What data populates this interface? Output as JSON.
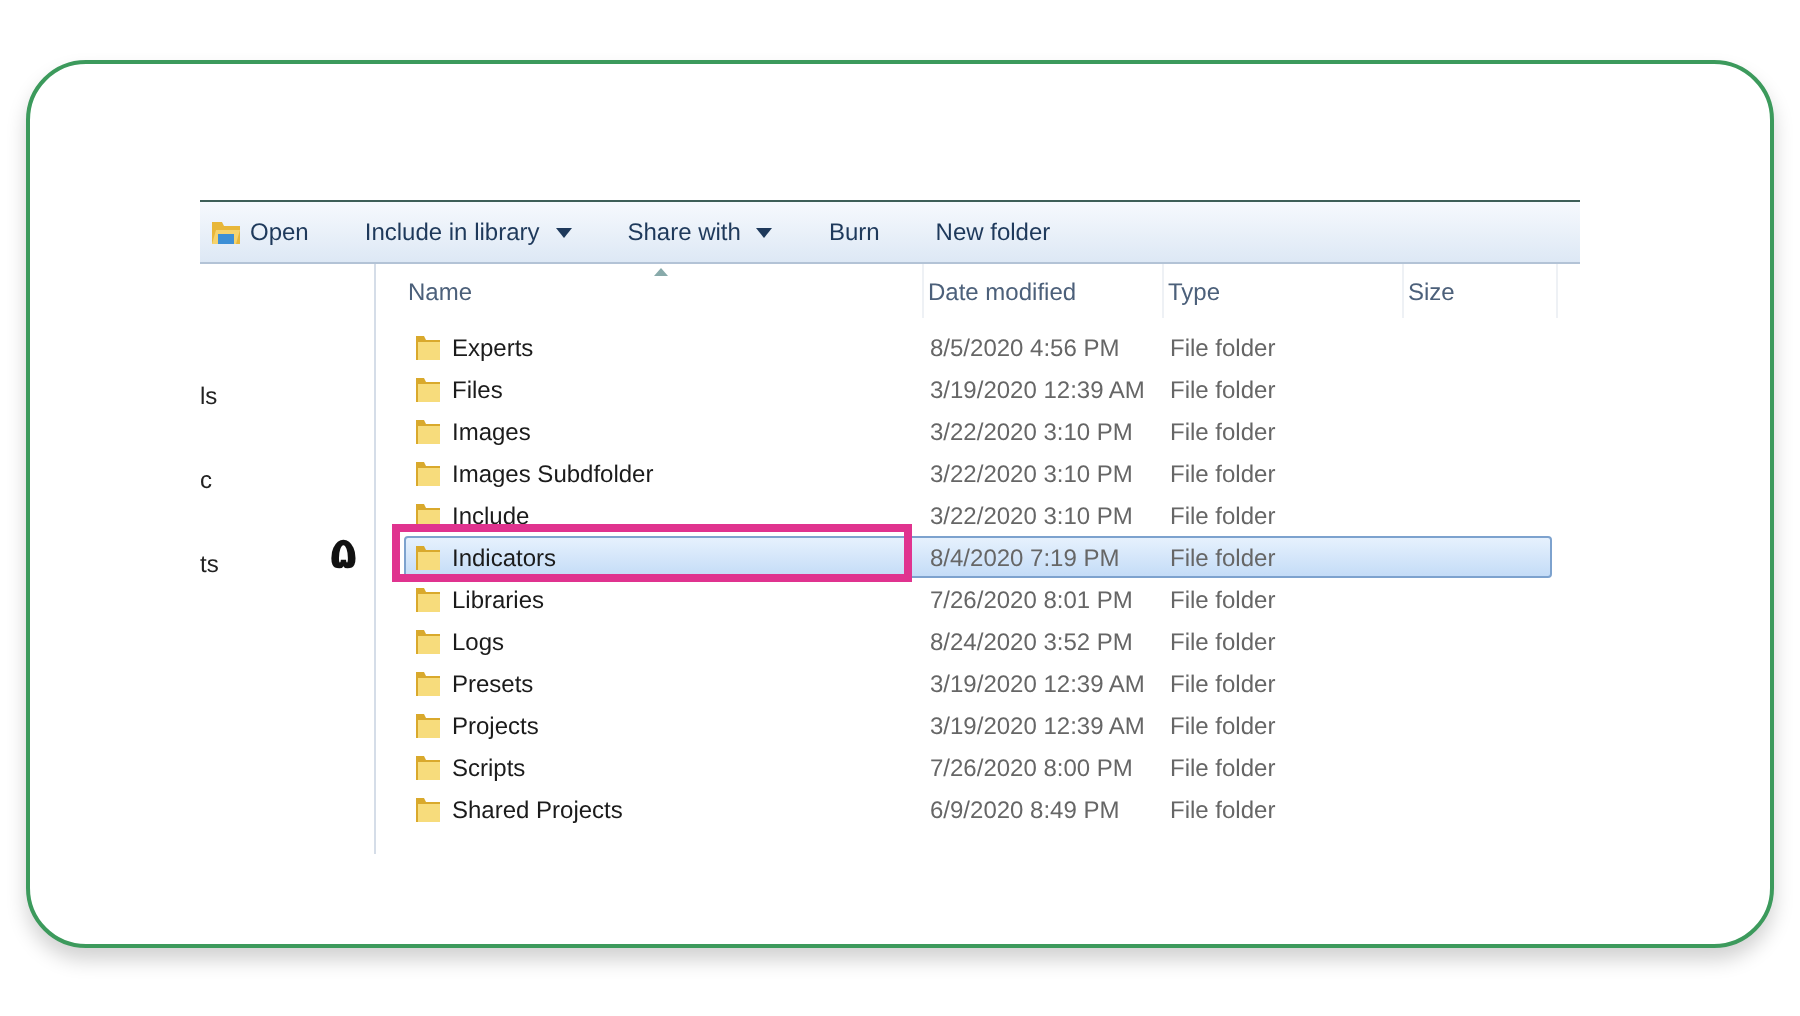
{
  "toolbar": [
    {
      "kind": "open",
      "label": "Open"
    },
    {
      "kind": "dropdown",
      "label": "Include in library"
    },
    {
      "kind": "dropdown",
      "label": "Share with"
    },
    {
      "kind": "plain",
      "label": "Burn"
    },
    {
      "kind": "plain",
      "label": "New folder"
    }
  ],
  "navigation_pane": {
    "items": [
      "ls",
      "c",
      "ts"
    ]
  },
  "columns": [
    {
      "label": "Name",
      "sorted": true
    },
    {
      "label": "Date modified",
      "sorted": false
    },
    {
      "label": "Type",
      "sorted": false
    },
    {
      "label": "Size",
      "sorted": false
    }
  ],
  "rows": [
    {
      "name": "Experts",
      "date": "8/5/2020 4:56 PM",
      "type": "File folder",
      "selected": false,
      "highlighted": false
    },
    {
      "name": "Files",
      "date": "3/19/2020 12:39 AM",
      "type": "File folder",
      "selected": false,
      "highlighted": false
    },
    {
      "name": "Images",
      "date": "3/22/2020 3:10 PM",
      "type": "File folder",
      "selected": false,
      "highlighted": false
    },
    {
      "name": "Images Subdfolder",
      "date": "3/22/2020 3:10 PM",
      "type": "File folder",
      "selected": false,
      "highlighted": false
    },
    {
      "name": "Include",
      "date": "3/22/2020 3:10 PM",
      "type": "File folder",
      "selected": false,
      "highlighted": false
    },
    {
      "name": "Indicators",
      "date": "8/4/2020 7:19 PM",
      "type": "File folder",
      "selected": true,
      "highlighted": true,
      "step": "۵"
    },
    {
      "name": "Libraries",
      "date": "7/26/2020 8:01 PM",
      "type": "File folder",
      "selected": false,
      "highlighted": false
    },
    {
      "name": "Logs",
      "date": "8/24/2020 3:52 PM",
      "type": "File folder",
      "selected": false,
      "highlighted": false
    },
    {
      "name": "Presets",
      "date": "3/19/2020 12:39 AM",
      "type": "File folder",
      "selected": false,
      "highlighted": false
    },
    {
      "name": "Projects",
      "date": "3/19/2020 12:39 AM",
      "type": "File folder",
      "selected": false,
      "highlighted": false
    },
    {
      "name": "Scripts",
      "date": "7/26/2020 8:00 PM",
      "type": "File folder",
      "selected": false,
      "highlighted": false
    },
    {
      "name": "Shared Projects",
      "date": "6/9/2020 8:49 PM",
      "type": "File folder",
      "selected": false,
      "highlighted": false
    }
  ]
}
